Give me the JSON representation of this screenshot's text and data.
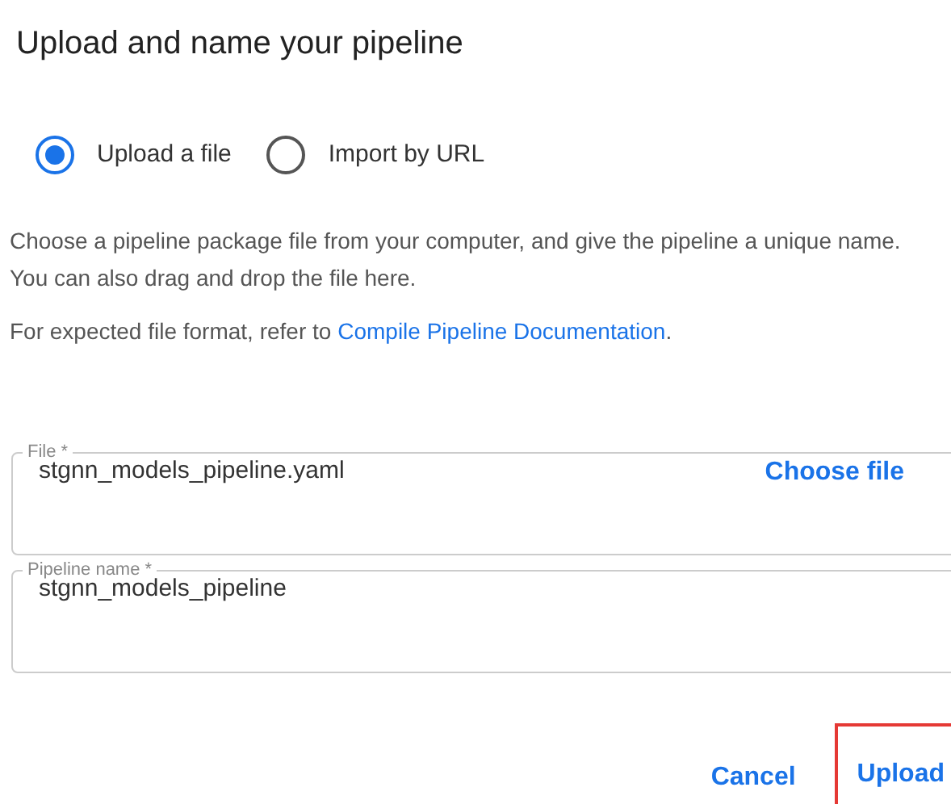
{
  "dialog": {
    "title": "Upload and name your pipeline"
  },
  "source_options": [
    {
      "label": "Upload a file",
      "selected": true
    },
    {
      "label": "Import by URL",
      "selected": false
    }
  ],
  "description": [
    "Choose a pipeline package file from your computer, and give the pipeline a unique name.",
    "You can also drag and drop the file here."
  ],
  "format_note": {
    "text": "For expected file format, refer to ",
    "link": "Compile Pipeline Documentation",
    "end": "."
  },
  "fields": [
    {
      "label": "File *",
      "value": "stgnn_models_pipeline.yaml",
      "action": "Choose file"
    },
    {
      "label": "Pipeline name *",
      "value": "stgnn_models_pipeline"
    }
  ],
  "buttons": [
    {
      "label": "Cancel",
      "highlighted": false
    },
    {
      "label": "Upload",
      "highlighted": true
    }
  ]
}
